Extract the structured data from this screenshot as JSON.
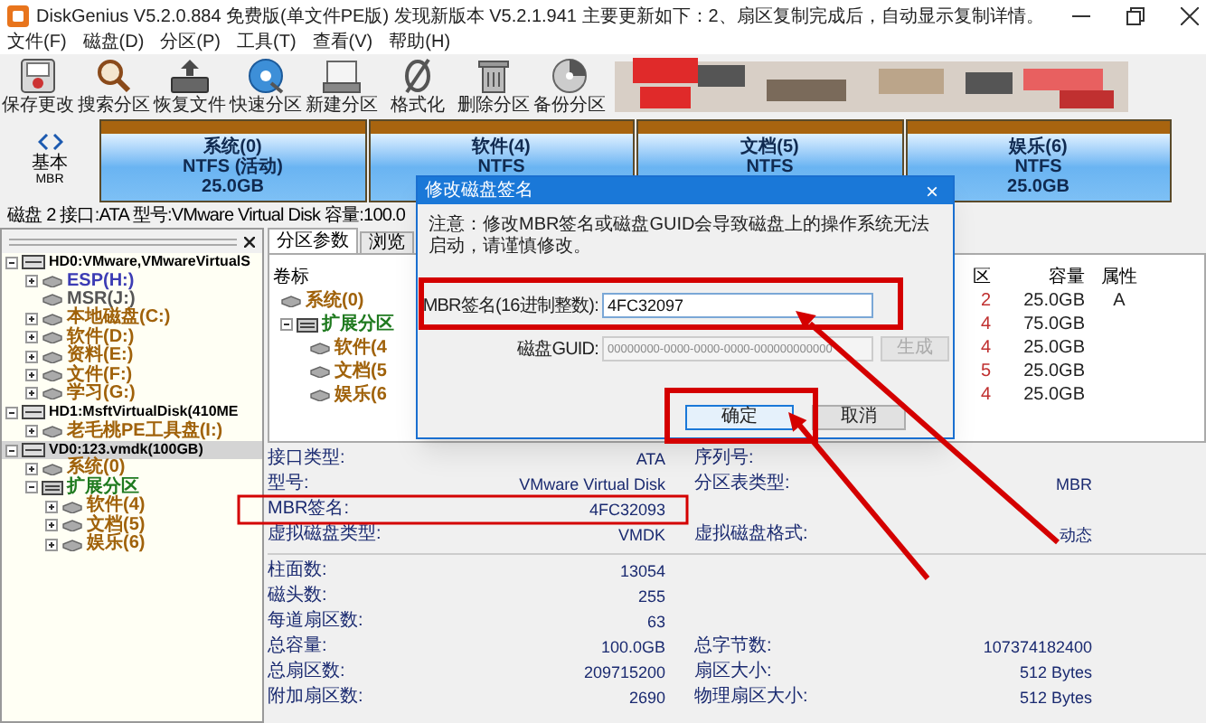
{
  "window": {
    "title": "DiskGenius V5.2.0.884 免费版(单文件PE版)  发现新版本 V5.2.1.941 主要更新如下：2、扇区复制完成后，自动显示复制详情。"
  },
  "menu": [
    "文件(F)",
    "磁盘(D)",
    "分区(P)",
    "工具(T)",
    "查看(V)",
    "帮助(H)"
  ],
  "toolbar": [
    {
      "label": "保存更改",
      "kind": "save"
    },
    {
      "label": "搜索分区",
      "kind": "search"
    },
    {
      "label": "恢复文件",
      "kind": "restore"
    },
    {
      "label": "快速分区",
      "kind": "quick"
    },
    {
      "label": "新建分区",
      "kind": "new"
    },
    {
      "label": "格式化",
      "kind": "format"
    },
    {
      "label": "删除分区",
      "kind": "delete"
    },
    {
      "label": "备份分区",
      "kind": "backup"
    }
  ],
  "disk_map": {
    "type_label": "基本",
    "scheme": "MBR",
    "partitions": [
      {
        "lines": [
          "系统(0)",
          "NTFS (活动)",
          "25.0GB"
        ]
      },
      {
        "lines": [
          "软件(4)",
          "NTFS"
        ]
      },
      {
        "lines": [
          "文档(5)",
          "NTFS"
        ]
      },
      {
        "lines": [
          "娱乐(6)",
          "NTFS",
          "25.0GB"
        ]
      }
    ]
  },
  "disk_info": "磁盘 2 接口:ATA 型号:VMware Virtual Disk 容量:100.0",
  "tree": [
    {
      "label": "HD0:VMware,VMwareVirtualS",
      "kind": "disk",
      "expanded": true,
      "selected": false,
      "children": [
        {
          "label": "ESP(H:)",
          "kind": "partition",
          "color": "#3c3cb4",
          "expanded": false,
          "selected": false
        },
        {
          "label": "MSR(J:)",
          "kind": "partition",
          "color": "#555555",
          "selected": false
        },
        {
          "label": "本地磁盘(C:)",
          "kind": "partition",
          "color": "#a0620a",
          "expanded": false,
          "selected": false
        },
        {
          "label": "软件(D:)",
          "kind": "partition",
          "color": "#a0620a",
          "expanded": false,
          "selected": false
        },
        {
          "label": "资料(E:)",
          "kind": "partition",
          "color": "#a0620a",
          "expanded": false,
          "selected": false
        },
        {
          "label": "文件(F:)",
          "kind": "partition",
          "color": "#a0620a",
          "expanded": false,
          "selected": false
        },
        {
          "label": "学习(G:)",
          "kind": "partition",
          "color": "#a0620a",
          "expanded": false,
          "selected": false
        }
      ]
    },
    {
      "label": "HD1:MsftVirtualDisk(410ME",
      "kind": "disk",
      "expanded": true,
      "selected": false,
      "children": [
        {
          "label": "老毛桃PE工具盘(I:)",
          "kind": "partition",
          "color": "#a0620a",
          "expanded": false,
          "selected": false
        }
      ]
    },
    {
      "label": "VD0:123.vmdk(100GB)",
      "kind": "disk",
      "expanded": true,
      "selected": true,
      "children": [
        {
          "label": "系统(0)",
          "kind": "partition",
          "color": "#a0620a",
          "expanded": false,
          "selected": false
        },
        {
          "label": "扩展分区",
          "kind": "extended",
          "color": "#1f7a1f",
          "expanded": true,
          "selected": false,
          "children": [
            {
              "label": "软件(4)",
              "kind": "partition",
              "color": "#a0620a",
              "expanded": false,
              "selected": false
            },
            {
              "label": "文档(5)",
              "kind": "partition",
              "color": "#a0620a",
              "expanded": false,
              "selected": false
            },
            {
              "label": "娱乐(6)",
              "kind": "partition",
              "color": "#a0620a",
              "expanded": false,
              "selected": false
            }
          ]
        }
      ]
    }
  ],
  "tabs": [
    {
      "label": "分区参数",
      "selected": true
    },
    {
      "label": "浏览",
      "selected": false
    }
  ],
  "partition_table": {
    "columns": [
      "卷标",
      "区",
      "容量",
      "属性"
    ],
    "rows": [
      {
        "name": "系统(0)",
        "kind": "partition",
        "color": "#a0620a",
        "column_2": "2",
        "capacity": "25.0GB",
        "attribute": "A"
      },
      {
        "name": "扩展分区",
        "kind": "extended",
        "color": "#1f7a1f",
        "expanded": true,
        "column_2": "4",
        "capacity": "75.0GB",
        "children": [
          {
            "name": "软件(4",
            "kind": "partition",
            "color": "#a0620a",
            "column_2": "4",
            "capacity": "25.0GB"
          },
          {
            "name": "文档(5",
            "kind": "partition",
            "color": "#a0620a",
            "column_2": "5",
            "capacity": "25.0GB"
          },
          {
            "name": "娱乐(6",
            "kind": "partition",
            "color": "#a0620a",
            "column_2": "4",
            "capacity": "25.0GB"
          }
        ]
      }
    ]
  },
  "details": [
    [
      {
        "left": {
          "label": "接口类型:",
          "value": "ATA"
        },
        "right": {
          "label": "序列号:"
        }
      },
      {
        "left": {
          "label": "型号:",
          "value": "VMware Virtual Disk"
        },
        "right": {
          "label": "分区表类型:",
          "value": "MBR"
        }
      },
      {
        "left": {
          "label": "MBR签名:",
          "value": "4FC32093"
        }
      },
      {
        "left": {
          "label": "虚拟磁盘类型:",
          "value": "VMDK"
        },
        "right": {
          "label": "虚拟磁盘格式:",
          "value": "动态"
        }
      }
    ],
    [
      {
        "left": {
          "label": "柱面数:",
          "value": "13054"
        }
      },
      {
        "left": {
          "label": "磁头数:",
          "value": "255"
        }
      },
      {
        "left": {
          "label": "每道扇区数:",
          "value": "63"
        }
      },
      {
        "left": {
          "label": "总容量:",
          "value": "100.0GB"
        },
        "right": {
          "label": "总字节数:",
          "value": "107374182400"
        }
      },
      {
        "left": {
          "label": "总扇区数:",
          "value": "209715200"
        },
        "right": {
          "label": "扇区大小:",
          "value": "512 Bytes"
        }
      },
      {
        "left": {
          "label": "附加扇区数:",
          "value": "2690"
        },
        "right": {
          "label": "物理扇区大小:",
          "value": "512 Bytes"
        }
      }
    ]
  ],
  "dialog": {
    "title": "修改磁盘签名",
    "close": "×",
    "note": "注意：修改MBR签名或磁盘GUID会导致磁盘上的操作系统无法启动，请谨慎修改。",
    "fields": [
      {
        "label": "MBR签名(16进制整数):",
        "value": "4FC32097",
        "disabled": false
      },
      {
        "label": "磁盘GUID:",
        "value": "00000000-0000-0000-0000-000000000000",
        "disabled": true,
        "button": "生成"
      }
    ],
    "buttons": [
      {
        "label": "确定",
        "kind": "primary"
      },
      {
        "label": "取消",
        "kind": "secondary"
      }
    ]
  }
}
